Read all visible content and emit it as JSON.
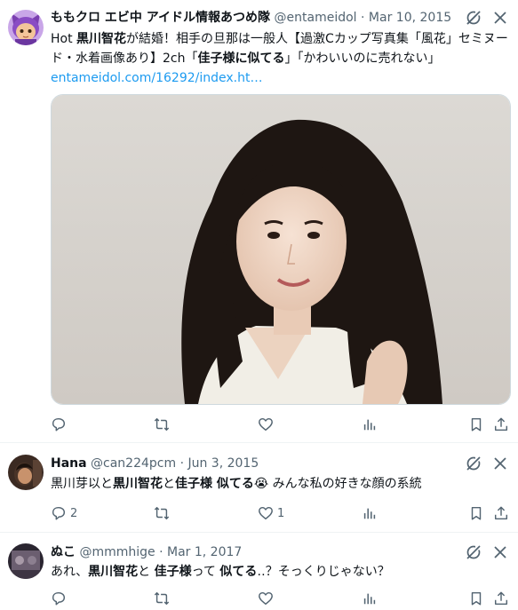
{
  "tweets": [
    {
      "name": "ももクロ エビ中 アイドル情報あつめ隊",
      "handle": "@entameidol",
      "date": "Mar 10, 2015",
      "body_parts": [
        {
          "text": "Hot ",
          "bold": false
        },
        {
          "text": "黒川智花",
          "bold": true
        },
        {
          "text": "が結婚！相手の旦那は一般人【過激Cカップ写真集「風花」セミヌード・水着画像あり】2ch「",
          "bold": false
        },
        {
          "text": "佳子様に似てる",
          "bold": true
        },
        {
          "text": "」「かわいいのに売れない」",
          "bold": false
        }
      ],
      "link": "entameidol.com/16292/index.ht…",
      "reply_count": "",
      "retweet_count": "",
      "like_count": ""
    },
    {
      "name": "Hana",
      "handle": "@can224pcm",
      "date": "Jun 3, 2015",
      "body_parts": [
        {
          "text": "黒川芽以と",
          "bold": false
        },
        {
          "text": "黒川智花",
          "bold": true
        },
        {
          "text": "と",
          "bold": false
        },
        {
          "text": "佳子様 似てる",
          "bold": true
        },
        {
          "text": "😭",
          "bold": false
        },
        {
          "text": " みんな私の好きな顔の系統",
          "bold": false
        }
      ],
      "reply_count": "2",
      "retweet_count": "",
      "like_count": "1"
    },
    {
      "name": "ぬこ",
      "handle": "@mmmhige",
      "date": "Mar 1, 2017",
      "body_parts": [
        {
          "text": "あれ、",
          "bold": false
        },
        {
          "text": "黒川智花",
          "bold": true
        },
        {
          "text": "と ",
          "bold": false
        },
        {
          "text": "佳子様",
          "bold": true
        },
        {
          "text": "って ",
          "bold": false
        },
        {
          "text": "似てる",
          "bold": true
        },
        {
          "text": "‥？そっくりじゃない？",
          "bold": false
        }
      ],
      "reply_count": "",
      "retweet_count": "",
      "like_count": ""
    }
  ],
  "icons": [
    "grok-icon",
    "more-icon",
    "reply-icon",
    "retweet-icon",
    "like-icon",
    "views-icon",
    "bookmark-icon",
    "share-icon"
  ],
  "colors": {
    "link": "#1d9bf0",
    "muted": "#536471",
    "text": "#0f1419",
    "border": "#eff3f4"
  }
}
